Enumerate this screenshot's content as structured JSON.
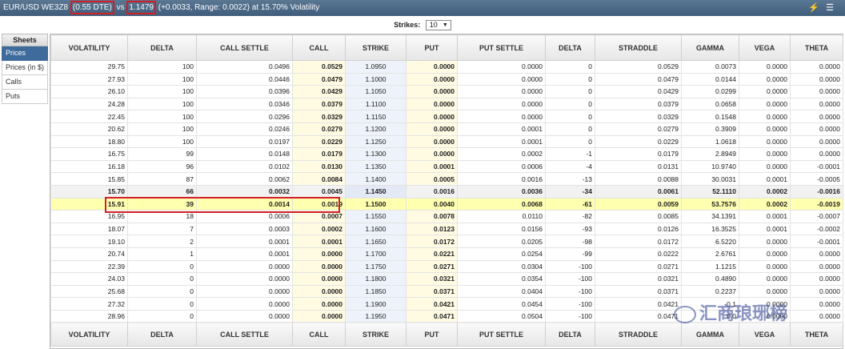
{
  "titlebar": {
    "instrument": "EUR/USD WE3Z8",
    "dte": "(0.55 DTE)",
    "vs": "vs",
    "spot": "1.1479",
    "detail": "(+0.0033,  Range: 0.0022) at 15.70% Volatility"
  },
  "strikes": {
    "label": "Strikes:",
    "value": "10"
  },
  "sidebar": {
    "header": "Sheets",
    "items": [
      {
        "label": "Prices",
        "active": true
      },
      {
        "label": "Prices (in $)",
        "active": false
      },
      {
        "label": "Calls",
        "active": false
      },
      {
        "label": "Puts",
        "active": false
      }
    ]
  },
  "columns": [
    "VOLATILITY",
    "DELTA",
    "CALL SETTLE",
    "CALL",
    "STRIKE",
    "PUT",
    "PUT SETTLE",
    "DELTA",
    "STRADDLE",
    "GAMMA",
    "VEGA",
    "THETA"
  ],
  "rows": [
    [
      "29.75",
      "100",
      "0.0496",
      "0.0529",
      "1.0950",
      "0.0000",
      "0.0000",
      "0",
      "0.0529",
      "0.0073",
      "0.0000",
      "0.0000"
    ],
    [
      "27.93",
      "100",
      "0.0446",
      "0.0479",
      "1.1000",
      "0.0000",
      "0.0000",
      "0",
      "0.0479",
      "0.0144",
      "0.0000",
      "0.0000"
    ],
    [
      "26.10",
      "100",
      "0.0396",
      "0.0429",
      "1.1050",
      "0.0000",
      "0.0000",
      "0",
      "0.0429",
      "0.0299",
      "0.0000",
      "0.0000"
    ],
    [
      "24.28",
      "100",
      "0.0346",
      "0.0379",
      "1.1100",
      "0.0000",
      "0.0000",
      "0",
      "0.0379",
      "0.0658",
      "0.0000",
      "0.0000"
    ],
    [
      "22.45",
      "100",
      "0.0296",
      "0.0329",
      "1.1150",
      "0.0000",
      "0.0000",
      "0",
      "0.0329",
      "0.1548",
      "0.0000",
      "0.0000"
    ],
    [
      "20.62",
      "100",
      "0.0246",
      "0.0279",
      "1.1200",
      "0.0000",
      "0.0001",
      "0",
      "0.0279",
      "0.3909",
      "0.0000",
      "0.0000"
    ],
    [
      "18.80",
      "100",
      "0.0197",
      "0.0229",
      "1.1250",
      "0.0000",
      "0.0001",
      "0",
      "0.0229",
      "1.0618",
      "0.0000",
      "0.0000"
    ],
    [
      "16.75",
      "99",
      "0.0148",
      "0.0179",
      "1.1300",
      "0.0000",
      "0.0002",
      "-1",
      "0.0179",
      "2.8949",
      "0.0000",
      "0.0000"
    ],
    [
      "16.18",
      "96",
      "0.0102",
      "0.0130",
      "1.1350",
      "0.0001",
      "0.0006",
      "-4",
      "0.0131",
      "10.9740",
      "0.0000",
      "-0.0001"
    ],
    [
      "15.85",
      "87",
      "0.0062",
      "0.0084",
      "1.1400",
      "0.0005",
      "0.0016",
      "-13",
      "0.0088",
      "30.0031",
      "0.0001",
      "-0.0005"
    ],
    [
      "15.70",
      "66",
      "0.0032",
      "0.0045",
      "1.1450",
      "0.0016",
      "0.0036",
      "-34",
      "0.0061",
      "52.1110",
      "0.0002",
      "-0.0016"
    ],
    [
      "15.91",
      "39",
      "0.0014",
      "0.0019",
      "1.1500",
      "0.0040",
      "0.0068",
      "-61",
      "0.0059",
      "53.7576",
      "0.0002",
      "-0.0019"
    ],
    [
      "16.95",
      "18",
      "0.0006",
      "0.0007",
      "1.1550",
      "0.0078",
      "0.0110",
      "-82",
      "0.0085",
      "34.1391",
      "0.0001",
      "-0.0007"
    ],
    [
      "18.07",
      "7",
      "0.0003",
      "0.0002",
      "1.1600",
      "0.0123",
      "0.0156",
      "-93",
      "0.0126",
      "16.3525",
      "0.0001",
      "-0.0002"
    ],
    [
      "19.10",
      "2",
      "0.0001",
      "0.0001",
      "1.1650",
      "0.0172",
      "0.0205",
      "-98",
      "0.0172",
      "6.5220",
      "0.0000",
      "-0.0001"
    ],
    [
      "20.74",
      "1",
      "0.0001",
      "0.0000",
      "1.1700",
      "0.0221",
      "0.0254",
      "-99",
      "0.0222",
      "2.6761",
      "0.0000",
      "0.0000"
    ],
    [
      "22.39",
      "0",
      "0.0000",
      "0.0000",
      "1.1750",
      "0.0271",
      "0.0304",
      "-100",
      "0.0271",
      "1.1215",
      "0.0000",
      "0.0000"
    ],
    [
      "24.03",
      "0",
      "0.0000",
      "0.0000",
      "1.1800",
      "0.0321",
      "0.0354",
      "-100",
      "0.0321",
      "0.4890",
      "0.0000",
      "0.0000"
    ],
    [
      "25.68",
      "0",
      "0.0000",
      "0.0000",
      "1.1850",
      "0.0371",
      "0.0404",
      "-100",
      "0.0371",
      "0.2237",
      "0.0000",
      "0.0000"
    ],
    [
      "27.32",
      "0",
      "0.0000",
      "0.0000",
      "1.1900",
      "0.0421",
      "0.0454",
      "-100",
      "0.0421",
      "0.1",
      "0.0000",
      "0.0000"
    ],
    [
      "28.96",
      "0",
      "0.0000",
      "0.0000",
      "1.1950",
      "0.0471",
      "0.0504",
      "-100",
      "0.0471",
      "0.0",
      "0.0000",
      "0.0000"
    ]
  ],
  "atm_row_index": 10,
  "current_row_index": 11,
  "watermark": "汇商琅琊榜",
  "colors": {
    "titlebar": "#4a6888",
    "highlight_box": "#d21f26",
    "current_row": "#ffffb0"
  }
}
